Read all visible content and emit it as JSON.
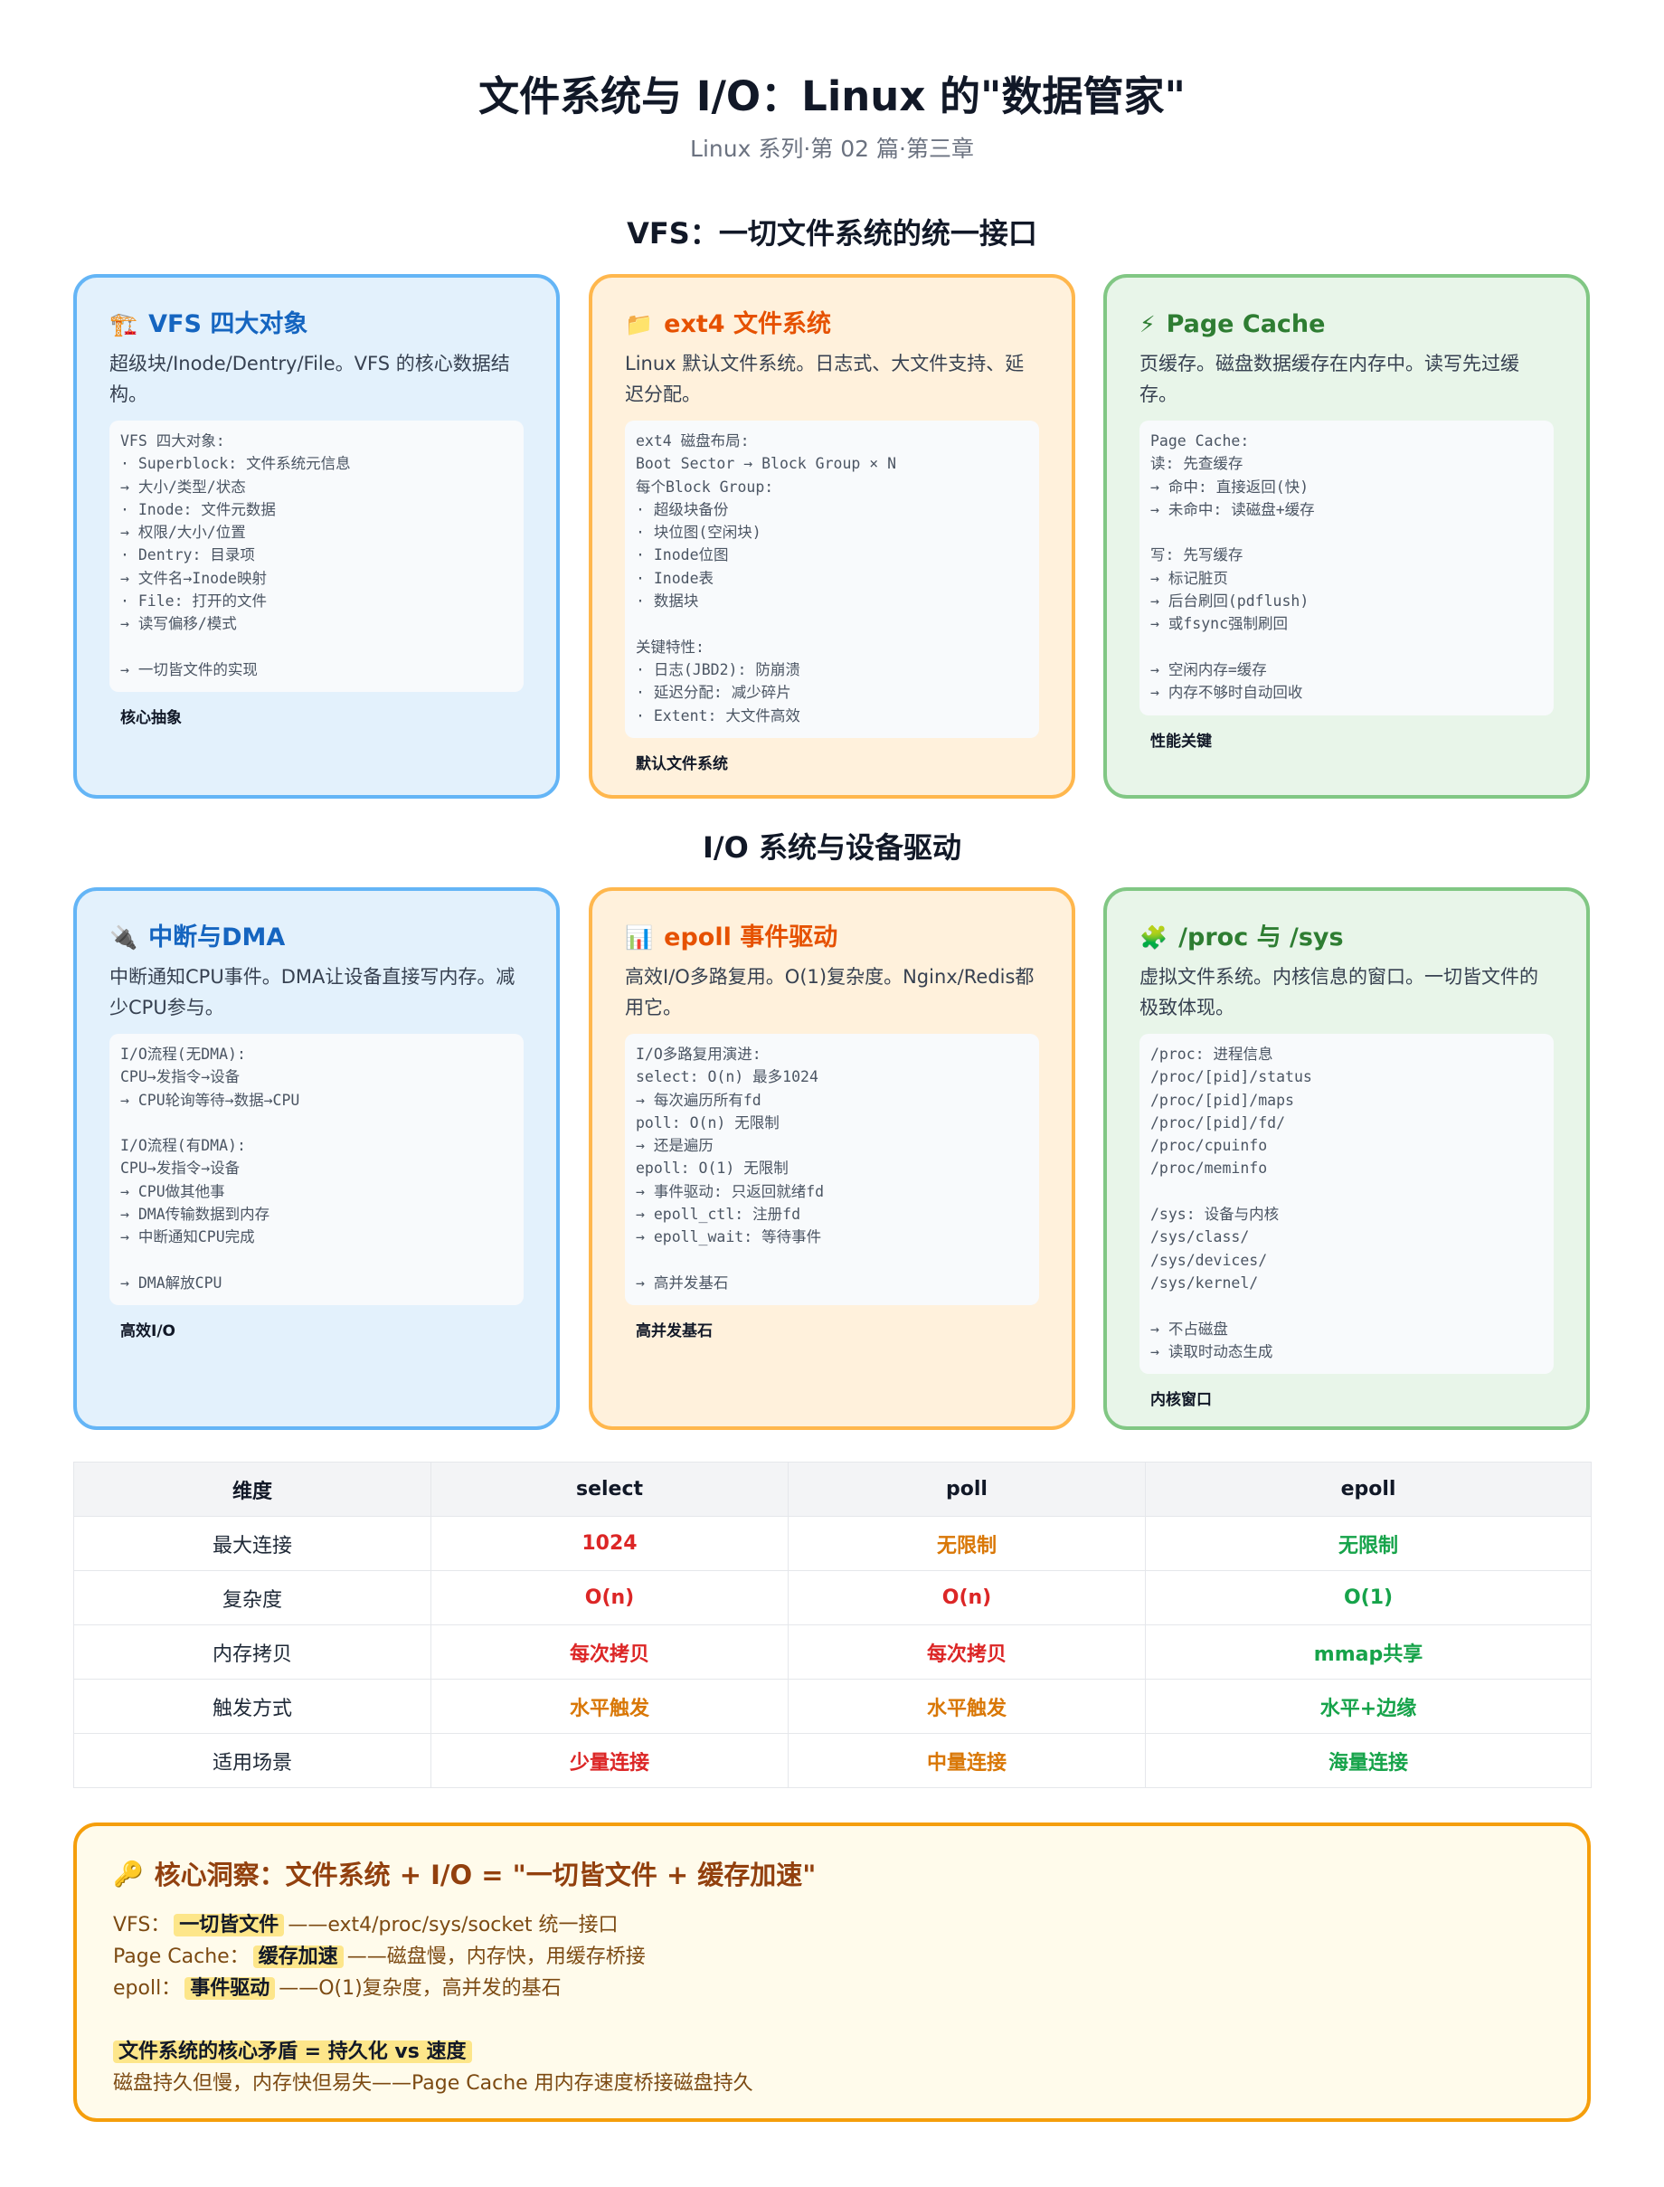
{
  "header": {
    "title": "文件系统与 I/O：Linux 的\"数据管家\"",
    "subtitle": "Linux 系列·第 02 篇·第三章"
  },
  "sections": {
    "vfs_title": "VFS：一切文件系统的统一接口",
    "io_title": "I/O 系统与设备驱动"
  },
  "cards": [
    {
      "icon": "🏗️",
      "icon_name": "construction-icon",
      "title": "VFS 四大对象",
      "desc": "超级块/Inode/Dentry/File。VFS 的核心数据结构。",
      "code": "VFS 四大对象:\n· Superblock: 文件系统元信息\n→ 大小/类型/状态\n· Inode: 文件元数据\n→ 权限/大小/位置\n· Dentry: 目录项\n→ 文件名→Inode映射\n· File: 打开的文件\n→ 读写偏移/模式\n\n→ 一切皆文件的实现",
      "tag": "核心抽象"
    },
    {
      "icon": "📁",
      "icon_name": "folder-icon",
      "title": "ext4 文件系统",
      "desc": "Linux 默认文件系统。日志式、大文件支持、延迟分配。",
      "code": "ext4 磁盘布局:\nBoot Sector → Block Group × N\n每个Block Group:\n· 超级块备份\n· 块位图(空闲块)\n· Inode位图\n· Inode表\n· 数据块\n\n关键特性:\n· 日志(JBD2): 防崩溃\n· 延迟分配: 减少碎片\n· Extent: 大文件高效",
      "tag": "默认文件系统"
    },
    {
      "icon": "⚡",
      "icon_name": "lightning-icon",
      "title": "Page Cache",
      "desc": "页缓存。磁盘数据缓存在内存中。读写先过缓存。",
      "code": "Page Cache:\n读: 先查缓存\n→ 命中: 直接返回(快)\n→ 未命中: 读磁盘+缓存\n\n写: 先写缓存\n→ 标记脏页\n→ 后台刷回(pdflush)\n→ 或fsync强制刷回\n\n→ 空闲内存=缓存\n→ 内存不够时自动回收",
      "tag": "性能关键"
    },
    {
      "icon": "🔌",
      "icon_name": "plug-icon",
      "title": "中断与DMA",
      "desc": "中断通知CPU事件。DMA让设备直接写内存。减少CPU参与。",
      "code": "I/O流程(无DMA):\nCPU→发指令→设备\n→ CPU轮询等待→数据→CPU\n\nI/O流程(有DMA):\nCPU→发指令→设备\n→ CPU做其他事\n→ DMA传输数据到内存\n→ 中断通知CPU完成\n\n→ DMA解放CPU",
      "tag": "高效I/O"
    },
    {
      "icon": "📊",
      "icon_name": "bar-chart-icon",
      "title": "epoll 事件驱动",
      "desc": "高效I/O多路复用。O(1)复杂度。Nginx/Redis都用它。",
      "code": "I/O多路复用演进:\nselect: O(n) 最多1024\n→ 每次遍历所有fd\npoll: O(n) 无限制\n→ 还是遍历\nepoll: O(1) 无限制\n→ 事件驱动: 只返回就绪fd\n→ epoll_ctl: 注册fd\n→ epoll_wait: 等待事件\n\n→ 高并发基石",
      "tag": "高并发基石"
    },
    {
      "icon": "🧩",
      "icon_name": "puzzle-icon",
      "title": "/proc 与 /sys",
      "desc": "虚拟文件系统。内核信息的窗口。一切皆文件的极致体现。",
      "code": "/proc: 进程信息\n/proc/[pid]/status\n/proc/[pid]/maps\n/proc/[pid]/fd/\n/proc/cpuinfo\n/proc/meminfo\n\n/sys: 设备与内核\n/sys/class/\n/sys/devices/\n/sys/kernel/\n\n→ 不占磁盘\n→ 读取时动态生成",
      "tag": "内核窗口"
    }
  ],
  "table": {
    "headers": [
      "维度",
      "select",
      "poll",
      "epoll"
    ],
    "rows": [
      [
        "最大连接",
        "1024",
        "无限制",
        "无限制"
      ],
      [
        "复杂度",
        "O(n)",
        "O(n)",
        "O(1)"
      ],
      [
        "内存拷贝",
        "每次拷贝",
        "每次拷贝",
        "mmap共享"
      ],
      [
        "触发方式",
        "水平触发",
        "水平触发",
        "水平+边缘"
      ],
      [
        "适用场景",
        "少量连接",
        "中量连接",
        "海量连接"
      ]
    ],
    "colors": {
      "red": "#dc2626",
      "amber": "#d97706",
      "green": "#16a34a"
    }
  },
  "insight": {
    "icon": "🔑",
    "icon_name": "key-icon",
    "title": "核心洞察：文件系统 + I/O = \"一切皆文件 + 缓存加速\"",
    "l1_pre": "VFS：",
    "l1_hl": "一切皆文件",
    "l1_post": "——ext4/proc/sys/socket 统一接口",
    "l2_pre": "Page Cache：",
    "l2_hl": "缓存加速",
    "l2_post": "——磁盘慢，内存快，用缓存桥接",
    "l3_pre": "epoll：",
    "l3_hl": "事件驱动",
    "l3_post": "——O(1)复杂度，高并发的基石",
    "l4_hl": "文件系统的核心矛盾 = 持久化 vs 速度",
    "l5": "磁盘持久但慢，内存快但易失——Page Cache 用内存速度桥接磁盘持久"
  }
}
